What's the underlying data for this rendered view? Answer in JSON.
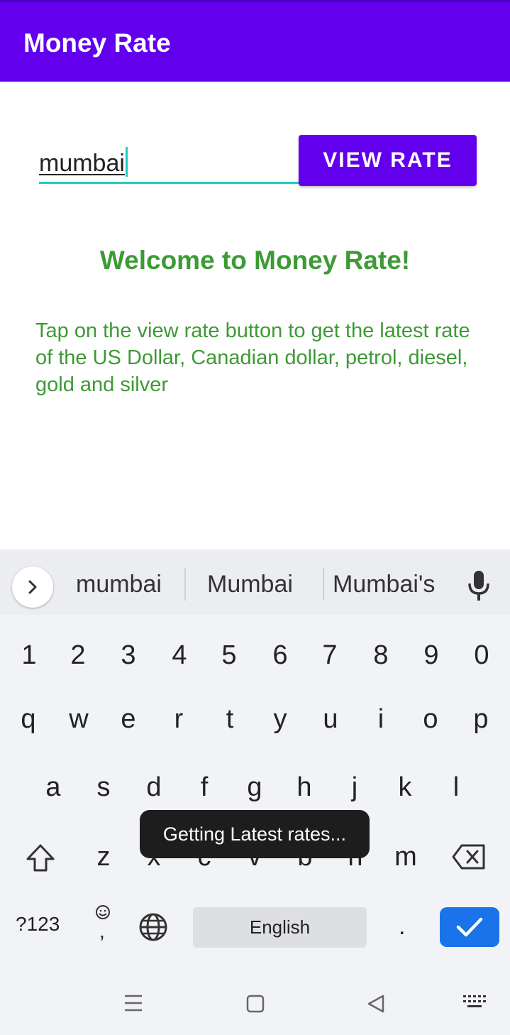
{
  "app": {
    "title": "Money Rate"
  },
  "search": {
    "value": "mumbai"
  },
  "actions": {
    "view_rate_label": "VIEW RATE"
  },
  "content": {
    "welcome": "Welcome to Money Rate!",
    "description": "Tap on the view rate button to get the latest rate of the US Dollar, Canadian dollar, petrol, diesel, gold and silver"
  },
  "keyboard": {
    "suggestions": [
      "mumbai",
      "Mumbai",
      "Mumbai's"
    ],
    "numbers": [
      "1",
      "2",
      "3",
      "4",
      "5",
      "6",
      "7",
      "8",
      "9",
      "0"
    ],
    "row1": [
      "q",
      "w",
      "e",
      "r",
      "t",
      "y",
      "u",
      "i",
      "o",
      "p"
    ],
    "row2": [
      "a",
      "s",
      "d",
      "f",
      "g",
      "h",
      "j",
      "k",
      "l"
    ],
    "row3": [
      "z",
      "x",
      "c",
      "v",
      "b",
      "n",
      "m"
    ],
    "symbols_label": "?123",
    "emoji_comma": ",",
    "space_label": "English",
    "period": "."
  },
  "toast": {
    "message": "Getting Latest rates..."
  },
  "colors": {
    "primary": "#6200ee",
    "accent": "#1ecbc0",
    "text_green": "#3d9a35",
    "enter_blue": "#1a73e8"
  }
}
